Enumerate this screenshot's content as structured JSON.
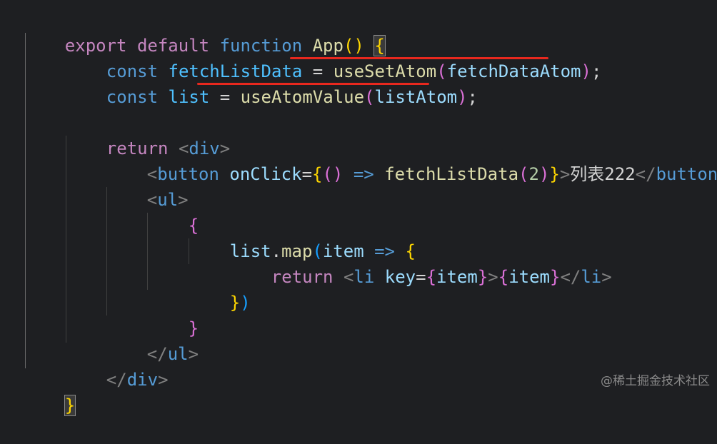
{
  "code": {
    "l1": {
      "kw_export": "export",
      "kw_default": "default",
      "kw_function": "function",
      "fn_app": "App",
      "parens": "()",
      "brace": "{"
    },
    "l2": {
      "kw_const": "const",
      "var": "fetchListData",
      "eq": "=",
      "fn": "useSetAtom",
      "p_open": "(",
      "arg": "fetchDataAtom",
      "p_close": ")",
      "semi": ";"
    },
    "l3": {
      "kw_const": "const",
      "var": "list",
      "eq": "=",
      "fn": "useAtomValue",
      "p_open": "(",
      "arg": "listAtom",
      "p_close": ")",
      "semi": ";"
    },
    "l5": {
      "kw_return": "return",
      "tag_open": "<",
      "tag_name": "div",
      "tag_close": ">"
    },
    "l6": {
      "lt": "<",
      "tag": "button",
      "attr": "onClick",
      "eq": "=",
      "b_open": "{",
      "p": "()",
      "arrow": "=>",
      "fn": "fetchListData",
      "p_open": "(",
      "num": "2",
      "p_close": ")",
      "b_close": "}",
      "gt": ">",
      "text": "列表222",
      "end_lt": "</",
      "end_tag": "button",
      "end_gt": ">"
    },
    "l7": {
      "lt": "<",
      "tag": "ul",
      "gt": ">"
    },
    "l8": {
      "brace": "{"
    },
    "l9": {
      "var": "list",
      "dot": ".",
      "fn": "map",
      "p_open": "(",
      "param": "item",
      "arrow": "=>",
      "b_open": "{"
    },
    "l10": {
      "kw_return": "return",
      "lt": "<",
      "tag": "li",
      "attr": "key",
      "eq": "=",
      "b_open": "{",
      "var": "item",
      "b_close": "}",
      "gt": ">",
      "b2_open": "{",
      "var2": "item",
      "b2_close": "}",
      "end_lt": "</",
      "end_tag": "li",
      "end_gt": ">"
    },
    "l11": {
      "b_close": "}",
      "p_close": ")"
    },
    "l12": {
      "brace": "}"
    },
    "l13": {
      "end_lt": "</",
      "tag": "ul",
      "gt": ">"
    },
    "l14": {
      "end_lt": "</",
      "tag": "div",
      "gt": ">"
    },
    "l15": {
      "brace": "}"
    }
  },
  "watermark": "@稀土掘金技术社区",
  "colors": {
    "background": "#1e1f22",
    "keyword": "#c586c0",
    "storage": "#569cd6",
    "function": "#dcdcaa",
    "variable": "#9cdcfe",
    "constant": "#4fc1ff",
    "underline": "#e8281e"
  }
}
